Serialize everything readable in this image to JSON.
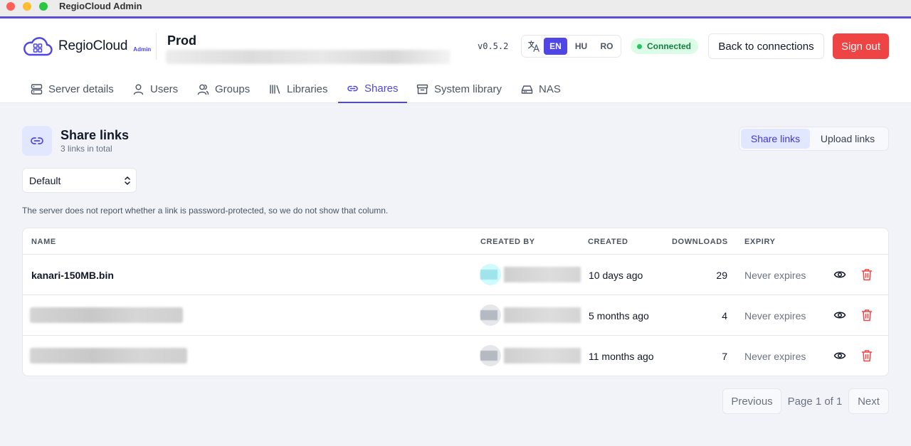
{
  "window": {
    "title": "RegioCloud Admin"
  },
  "header": {
    "brand": "RegioCloud",
    "brand_badge": "Admin",
    "server_name": "Prod",
    "version": "v0.5.2",
    "languages": [
      "EN",
      "HU",
      "RO"
    ],
    "active_language": "EN",
    "status": "Connected",
    "back_button": "Back to connections",
    "signout_button": "Sign out"
  },
  "tabs": [
    {
      "label": "Server details",
      "icon": "server-icon"
    },
    {
      "label": "Users",
      "icon": "user-icon"
    },
    {
      "label": "Groups",
      "icon": "group-icon"
    },
    {
      "label": "Libraries",
      "icon": "library-icon"
    },
    {
      "label": "Shares",
      "icon": "link-icon",
      "active": true
    },
    {
      "label": "System library",
      "icon": "archive-icon"
    },
    {
      "label": "NAS",
      "icon": "hard-drive-icon"
    }
  ],
  "section": {
    "title": "Share links",
    "subtitle": "3 links in total",
    "toggle": [
      "Share links",
      "Upload links"
    ],
    "toggle_active": "Share links",
    "filter_value": "Default",
    "note": "The server does not report whether a link is password-protected, so we do not show that column."
  },
  "table": {
    "columns": [
      "NAME",
      "CREATED BY",
      "CREATED",
      "DOWNLOADS",
      "EXPIRY"
    ],
    "rows": [
      {
        "name": "kanari-150MB.bin",
        "created": "10 days ago",
        "downloads": "29",
        "expiry": "Never expires"
      },
      {
        "name": "",
        "created": "5 months ago",
        "downloads": "4",
        "expiry": "Never expires"
      },
      {
        "name": "",
        "created": "11 months ago",
        "downloads": "7",
        "expiry": "Never expires"
      }
    ]
  },
  "pagination": {
    "previous": "Previous",
    "page_label": "Page 1 of 1",
    "next": "Next"
  },
  "colors": {
    "accent": "#4f46e5",
    "danger": "#ef4444",
    "success": "#15803d"
  }
}
